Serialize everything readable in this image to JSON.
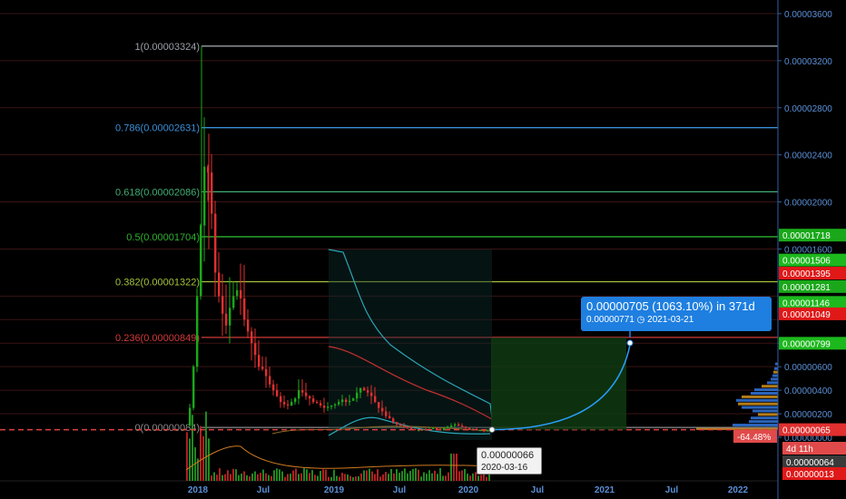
{
  "chart_data": {
    "type": "candlestick",
    "ylim": [
      0,
      3.7e-05
    ],
    "x_ticks": [
      "2018",
      "Jul",
      "2019",
      "Jul",
      "2020",
      "Jul",
      "2021",
      "Jul",
      "2022"
    ],
    "y_ticks": [
      "0.00003600",
      "0.00003200",
      "0.00002800",
      "0.00002400",
      "0.00002000",
      "0.00001600",
      "0.00000800",
      "0.00000600",
      "0.00000400",
      "0.00000200",
      "0.00000000"
    ],
    "y_tick_values": [
      3.6e-05,
      3.2e-05,
      2.8e-05,
      2.4e-05,
      2e-05,
      1.6e-05,
      8e-06,
      6e-06,
      4e-06,
      2e-06,
      0.0
    ],
    "fib_levels": [
      {
        "label": "1(0.00003324)",
        "value": 3.324e-05,
        "color": "#9aa0a8"
      },
      {
        "label": "0.786(0.00002631)",
        "value": 2.631e-05,
        "color": "#3a8fd6"
      },
      {
        "label": "0.618(0.00002086)",
        "value": 2.086e-05,
        "color": "#3fae73"
      },
      {
        "label": "0.5(0.00001704)",
        "value": 1.704e-05,
        "color": "#2fb02f"
      },
      {
        "label": "0.382(0.00001322)",
        "value": 1.322e-05,
        "color": "#a4c23a"
      },
      {
        "label": "0.236(0.00000849)",
        "value": 8.49e-06,
        "color": "#d33a3a"
      },
      {
        "label": "0(0.00000084)",
        "value": 8.4e-07,
        "color": "#8a8a8a"
      }
    ],
    "price_badges": [
      {
        "text": "0.00001718",
        "value": 1.718e-05,
        "bg": "#1aa81a",
        "fg": "#000"
      },
      {
        "text": "0.00001506",
        "value": 1.506e-05,
        "bg": "#1db81d",
        "fg": "#000"
      },
      {
        "text": "0.00001395",
        "value": 1.395e-05,
        "bg": "#e01818",
        "fg": "#fff"
      },
      {
        "text": "0.00001281",
        "value": 1.281e-05,
        "bg": "#1aa81a",
        "fg": "#000"
      },
      {
        "text": "0.00001146",
        "value": 1.146e-05,
        "bg": "#1db81d",
        "fg": "#000"
      },
      {
        "text": "0.00001049",
        "value": 1.049e-05,
        "bg": "#e01818",
        "fg": "#fff"
      },
      {
        "text": "0.00000799",
        "value": 7.99e-06,
        "bg": "#1db81d",
        "fg": "#000"
      },
      {
        "text": "0.00000065",
        "value": 6.5e-07,
        "bg": "#e03030",
        "fg": "#fff"
      }
    ],
    "lower_badges": [
      {
        "text": "-64.48%",
        "bg": "#e04a4a",
        "fg": "#fff"
      },
      {
        "text": "4d 11h",
        "bg": "#e04a4a",
        "fg": "#fff"
      },
      {
        "text": "0.00000064",
        "bg": "#3a3a3a",
        "fg": "#fff"
      },
      {
        "text": "0.00000013",
        "bg": "#e01818",
        "fg": "#fff"
      }
    ],
    "current_price": 6.5e-07,
    "projection": {
      "main_text": "0.00000705 (1063.10%) in 371d",
      "price": "0.00000771",
      "date": "2021-03-21",
      "clock_icon": "clock-icon"
    },
    "tooltip": {
      "value": "0.00000066",
      "date": "2020-03-16"
    },
    "colors": {
      "up": "#1aa81a",
      "down": "#e03030",
      "axis": "#2f5fa8",
      "grid": "#3a1414"
    }
  }
}
